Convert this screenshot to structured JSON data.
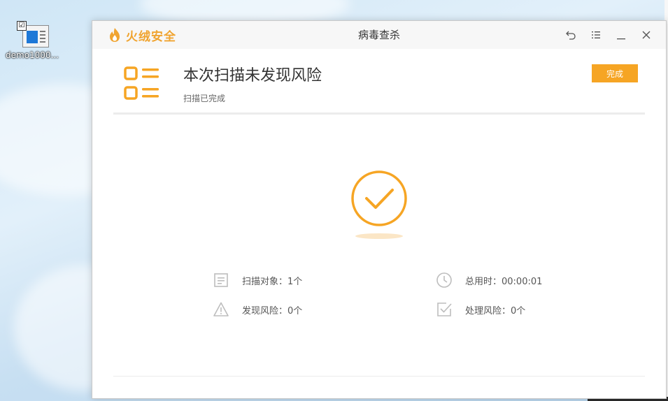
{
  "desktop": {
    "icon_label": "demo1000...",
    "checkbox_glyph": "☑"
  },
  "window": {
    "brand_name": "火绒安全",
    "title": "病毒查杀",
    "controls": [
      "back-icon",
      "menu-icon",
      "minimize-icon",
      "close-icon"
    ]
  },
  "header": {
    "title": "本次扫描未发现风险",
    "subtitle": "扫描已完成",
    "done_label": "完成"
  },
  "stats": [
    {
      "label": "扫描对象：1个",
      "icon": "document-icon"
    },
    {
      "label": "总用时：00:00:01",
      "icon": "clock-icon"
    },
    {
      "label": "发现风险：0个",
      "icon": "warning-icon"
    },
    {
      "label": "处理风险：0个",
      "icon": "checkbox-icon"
    }
  ],
  "colors": {
    "accent": "#f6a524",
    "brand": "#f0a430",
    "icon_gray": "#bdbdbd"
  }
}
